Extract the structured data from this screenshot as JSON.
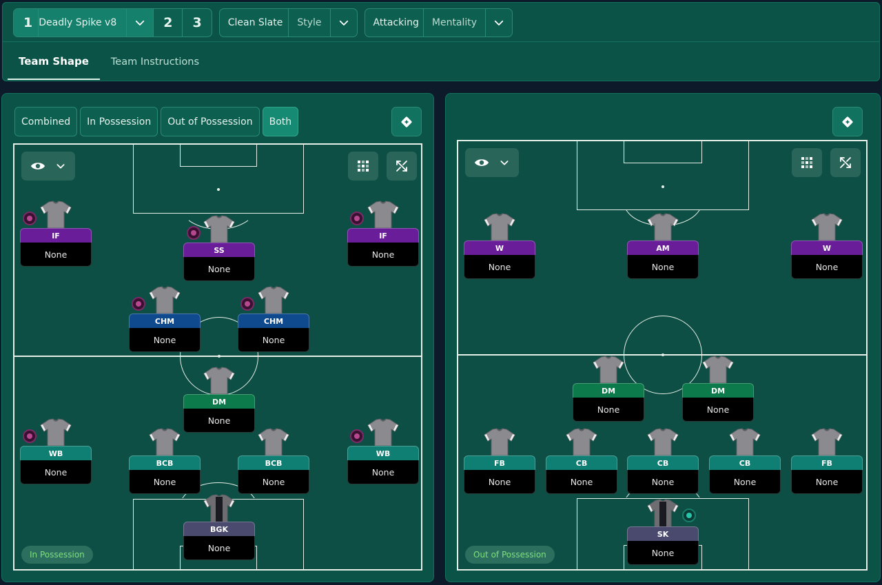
{
  "toolbar": {
    "tactic_slot": "1",
    "tactic_name": "Deadly Spike v8",
    "slot_2": "2",
    "slot_3": "3",
    "style_value": "Clean Slate",
    "style_label": "Style",
    "mentality_value": "Attacking",
    "mentality_label": "Mentality"
  },
  "tabs": [
    "Team Shape",
    "Team Instructions"
  ],
  "view_tabs": [
    "Combined",
    "In Possession",
    "Out of Possession",
    "Both"
  ],
  "left_panel": {
    "mode": "In Possession",
    "players": [
      {
        "role": "IF",
        "duty": "None",
        "color": "purple",
        "badge": true
      },
      {
        "role": "SS",
        "duty": "None",
        "color": "purple",
        "badge": true
      },
      {
        "role": "IF",
        "duty": "None",
        "color": "purple",
        "badge": true
      },
      {
        "role": "CHM",
        "duty": "None",
        "color": "blue",
        "badge": true
      },
      {
        "role": "CHM",
        "duty": "None",
        "color": "blue",
        "badge": true
      },
      {
        "role": "DM",
        "duty": "None",
        "color": "green",
        "badge": false
      },
      {
        "role": "WB",
        "duty": "None",
        "color": "teal",
        "badge": true
      },
      {
        "role": "BCB",
        "duty": "None",
        "color": "teal",
        "badge": false
      },
      {
        "role": "BCB",
        "duty": "None",
        "color": "teal",
        "badge": false
      },
      {
        "role": "WB",
        "duty": "None",
        "color": "teal",
        "badge": true
      },
      {
        "role": "BGK",
        "duty": "None",
        "color": "slate",
        "badge": false
      }
    ]
  },
  "right_panel": {
    "mode": "Out of Possession",
    "players": [
      {
        "role": "W",
        "duty": "None",
        "color": "purple"
      },
      {
        "role": "AM",
        "duty": "None",
        "color": "purple"
      },
      {
        "role": "W",
        "duty": "None",
        "color": "purple"
      },
      {
        "role": "DM",
        "duty": "None",
        "color": "green"
      },
      {
        "role": "DM",
        "duty": "None",
        "color": "green"
      },
      {
        "role": "FB",
        "duty": "None",
        "color": "teal"
      },
      {
        "role": "CB",
        "duty": "None",
        "color": "teal"
      },
      {
        "role": "CB",
        "duty": "None",
        "color": "teal"
      },
      {
        "role": "CB",
        "duty": "None",
        "color": "teal"
      },
      {
        "role": "FB",
        "duty": "None",
        "color": "teal"
      },
      {
        "role": "SK",
        "duty": "None",
        "color": "slate"
      }
    ]
  },
  "colors": {
    "purple": "#6a1d99",
    "blue": "#0f4a8e",
    "green": "#0c7a4a",
    "teal": "#0f7f73",
    "slate": "#4a4a6e",
    "pitch": "#0d4f44",
    "panel": "#0a5346"
  },
  "icons": [
    "chevron-down-icon",
    "eye-icon",
    "grid-icon",
    "expand-icon",
    "tactic-icon"
  ]
}
